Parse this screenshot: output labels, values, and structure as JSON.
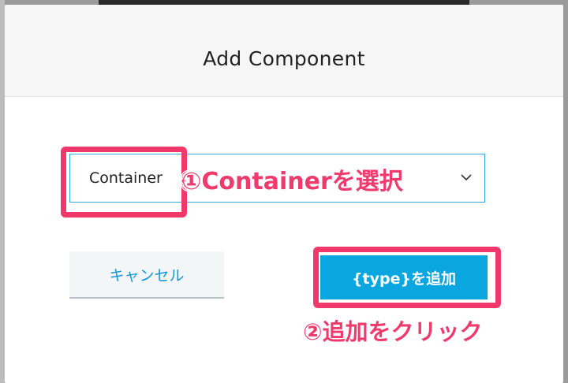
{
  "dialog": {
    "title": "Add Component",
    "select": {
      "value": "Container"
    },
    "cancel_label": "キャンセル",
    "add_label": "{type}を追加"
  },
  "annotations": {
    "step1": "①Containerを選択",
    "step2": "②追加をクリック"
  },
  "colors": {
    "highlight": "#f0386b",
    "primary_button": "#0aa6e0",
    "link_text": "#1397d4",
    "select_border": "#2fa9e0"
  },
  "icons": {
    "select_arrow": "chevron-down-icon"
  }
}
